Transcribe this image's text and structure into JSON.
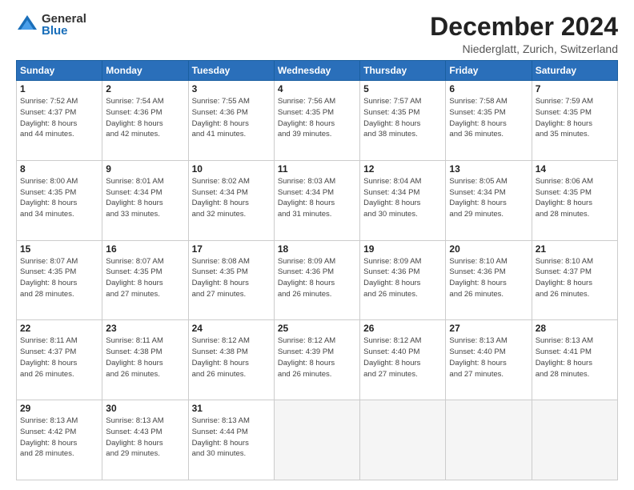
{
  "logo": {
    "general": "General",
    "blue": "Blue"
  },
  "title": "December 2024",
  "subtitle": "Niederglatt, Zurich, Switzerland",
  "days_of_week": [
    "Sunday",
    "Monday",
    "Tuesday",
    "Wednesday",
    "Thursday",
    "Friday",
    "Saturday"
  ],
  "weeks": [
    [
      {
        "day": "1",
        "info": "Sunrise: 7:52 AM\nSunset: 4:37 PM\nDaylight: 8 hours\nand 44 minutes."
      },
      {
        "day": "2",
        "info": "Sunrise: 7:54 AM\nSunset: 4:36 PM\nDaylight: 8 hours\nand 42 minutes."
      },
      {
        "day": "3",
        "info": "Sunrise: 7:55 AM\nSunset: 4:36 PM\nDaylight: 8 hours\nand 41 minutes."
      },
      {
        "day": "4",
        "info": "Sunrise: 7:56 AM\nSunset: 4:35 PM\nDaylight: 8 hours\nand 39 minutes."
      },
      {
        "day": "5",
        "info": "Sunrise: 7:57 AM\nSunset: 4:35 PM\nDaylight: 8 hours\nand 38 minutes."
      },
      {
        "day": "6",
        "info": "Sunrise: 7:58 AM\nSunset: 4:35 PM\nDaylight: 8 hours\nand 36 minutes."
      },
      {
        "day": "7",
        "info": "Sunrise: 7:59 AM\nSunset: 4:35 PM\nDaylight: 8 hours\nand 35 minutes."
      }
    ],
    [
      {
        "day": "8",
        "info": "Sunrise: 8:00 AM\nSunset: 4:35 PM\nDaylight: 8 hours\nand 34 minutes."
      },
      {
        "day": "9",
        "info": "Sunrise: 8:01 AM\nSunset: 4:34 PM\nDaylight: 8 hours\nand 33 minutes."
      },
      {
        "day": "10",
        "info": "Sunrise: 8:02 AM\nSunset: 4:34 PM\nDaylight: 8 hours\nand 32 minutes."
      },
      {
        "day": "11",
        "info": "Sunrise: 8:03 AM\nSunset: 4:34 PM\nDaylight: 8 hours\nand 31 minutes."
      },
      {
        "day": "12",
        "info": "Sunrise: 8:04 AM\nSunset: 4:34 PM\nDaylight: 8 hours\nand 30 minutes."
      },
      {
        "day": "13",
        "info": "Sunrise: 8:05 AM\nSunset: 4:34 PM\nDaylight: 8 hours\nand 29 minutes."
      },
      {
        "day": "14",
        "info": "Sunrise: 8:06 AM\nSunset: 4:35 PM\nDaylight: 8 hours\nand 28 minutes."
      }
    ],
    [
      {
        "day": "15",
        "info": "Sunrise: 8:07 AM\nSunset: 4:35 PM\nDaylight: 8 hours\nand 28 minutes."
      },
      {
        "day": "16",
        "info": "Sunrise: 8:07 AM\nSunset: 4:35 PM\nDaylight: 8 hours\nand 27 minutes."
      },
      {
        "day": "17",
        "info": "Sunrise: 8:08 AM\nSunset: 4:35 PM\nDaylight: 8 hours\nand 27 minutes."
      },
      {
        "day": "18",
        "info": "Sunrise: 8:09 AM\nSunset: 4:36 PM\nDaylight: 8 hours\nand 26 minutes."
      },
      {
        "day": "19",
        "info": "Sunrise: 8:09 AM\nSunset: 4:36 PM\nDaylight: 8 hours\nand 26 minutes."
      },
      {
        "day": "20",
        "info": "Sunrise: 8:10 AM\nSunset: 4:36 PM\nDaylight: 8 hours\nand 26 minutes."
      },
      {
        "day": "21",
        "info": "Sunrise: 8:10 AM\nSunset: 4:37 PM\nDaylight: 8 hours\nand 26 minutes."
      }
    ],
    [
      {
        "day": "22",
        "info": "Sunrise: 8:11 AM\nSunset: 4:37 PM\nDaylight: 8 hours\nand 26 minutes."
      },
      {
        "day": "23",
        "info": "Sunrise: 8:11 AM\nSunset: 4:38 PM\nDaylight: 8 hours\nand 26 minutes."
      },
      {
        "day": "24",
        "info": "Sunrise: 8:12 AM\nSunset: 4:38 PM\nDaylight: 8 hours\nand 26 minutes."
      },
      {
        "day": "25",
        "info": "Sunrise: 8:12 AM\nSunset: 4:39 PM\nDaylight: 8 hours\nand 26 minutes."
      },
      {
        "day": "26",
        "info": "Sunrise: 8:12 AM\nSunset: 4:40 PM\nDaylight: 8 hours\nand 27 minutes."
      },
      {
        "day": "27",
        "info": "Sunrise: 8:13 AM\nSunset: 4:40 PM\nDaylight: 8 hours\nand 27 minutes."
      },
      {
        "day": "28",
        "info": "Sunrise: 8:13 AM\nSunset: 4:41 PM\nDaylight: 8 hours\nand 28 minutes."
      }
    ],
    [
      {
        "day": "29",
        "info": "Sunrise: 8:13 AM\nSunset: 4:42 PM\nDaylight: 8 hours\nand 28 minutes."
      },
      {
        "day": "30",
        "info": "Sunrise: 8:13 AM\nSunset: 4:43 PM\nDaylight: 8 hours\nand 29 minutes."
      },
      {
        "day": "31",
        "info": "Sunrise: 8:13 AM\nSunset: 4:44 PM\nDaylight: 8 hours\nand 30 minutes."
      },
      {
        "day": "",
        "info": ""
      },
      {
        "day": "",
        "info": ""
      },
      {
        "day": "",
        "info": ""
      },
      {
        "day": "",
        "info": ""
      }
    ]
  ]
}
